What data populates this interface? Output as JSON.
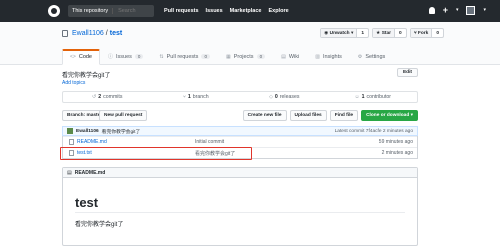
{
  "header": {
    "scope_label": "This repository",
    "search_placeholder": "Search",
    "nav": [
      "Pull requests",
      "Issues",
      "Marketplace",
      "Explore"
    ],
    "plus": "+"
  },
  "repo": {
    "owner": "Ewall1106",
    "separator": "/",
    "name": "test",
    "actions": [
      {
        "label": "Unwatch",
        "count": "1"
      },
      {
        "label": "Star",
        "count": "0"
      },
      {
        "label": "Fork",
        "count": "0"
      }
    ],
    "tabs": [
      {
        "label": "Code",
        "count": ""
      },
      {
        "label": "Issues",
        "count": "0"
      },
      {
        "label": "Pull requests",
        "count": "0"
      },
      {
        "label": "Projects",
        "count": "0"
      },
      {
        "label": "Wiki",
        "count": ""
      },
      {
        "label": "Insights",
        "count": ""
      },
      {
        "label": "Settings",
        "count": ""
      }
    ]
  },
  "summary": {
    "description": "看完你教学会git了",
    "add_topics": "Add topics",
    "edit": "Edit",
    "numbers": [
      {
        "value": "2",
        "label": "commits"
      },
      {
        "value": "1",
        "label": "branch"
      },
      {
        "value": "0",
        "label": "releases"
      },
      {
        "value": "1",
        "label": "contributor"
      }
    ]
  },
  "file_nav": {
    "branch": "Branch: master ▾",
    "new_pr": "New pull request",
    "actions": [
      "Create new file",
      "Upload files",
      "Find file"
    ],
    "clone": "Clone or download ▾"
  },
  "commit": {
    "author": "Ewall1106",
    "message": "看完你教学会git了",
    "meta": "Latest commit 7f4acfe 2 minutes ago"
  },
  "files": [
    {
      "name": "README.md",
      "message": "Initial commit",
      "age": "59 minutes ago"
    },
    {
      "name": "test.txt",
      "message": "看完你教学会git了",
      "age": "2 minutes ago"
    }
  ],
  "readme": {
    "header": "README.md",
    "title": "test",
    "body": "看完你教学会git了"
  }
}
